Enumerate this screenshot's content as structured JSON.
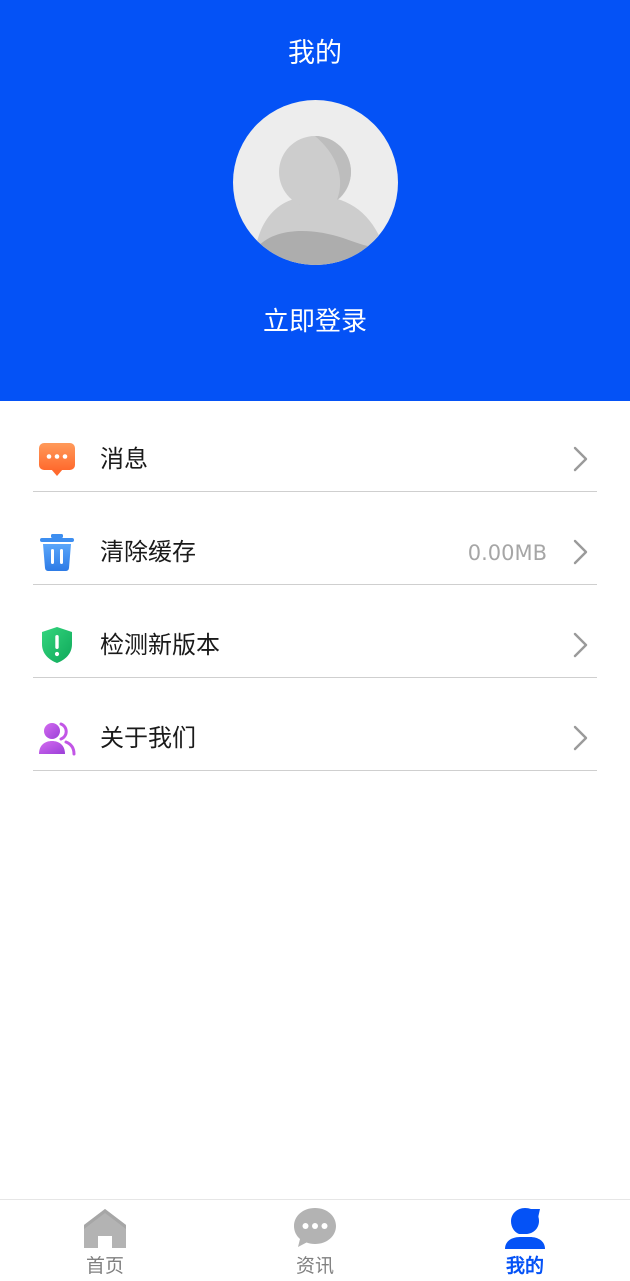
{
  "header": {
    "title": "我的",
    "login_label": "立即登录",
    "background": "#0452F6",
    "avatar_icon": "default-avatar-icon"
  },
  "menu": {
    "items": [
      {
        "label": "消息",
        "value": "",
        "icon": "message-icon",
        "icon_color": "#FF7A3C"
      },
      {
        "label": "清除缓存",
        "value": "0.00MB",
        "icon": "trash-icon",
        "icon_color": "#3D8EF0"
      },
      {
        "label": "检测新版本",
        "value": "",
        "icon": "shield-icon",
        "icon_color": "#1EC46A"
      },
      {
        "label": "关于我们",
        "value": "",
        "icon": "users-icon",
        "icon_color": "#C256E6"
      }
    ]
  },
  "bottom_nav": {
    "items": [
      {
        "label": "首页",
        "icon": "home-icon",
        "active": false
      },
      {
        "label": "资讯",
        "icon": "chat-icon",
        "active": false
      },
      {
        "label": "我的",
        "icon": "user-icon",
        "active": true
      }
    ],
    "active_color": "#0452F6",
    "inactive_color": "#B3B3B3"
  }
}
